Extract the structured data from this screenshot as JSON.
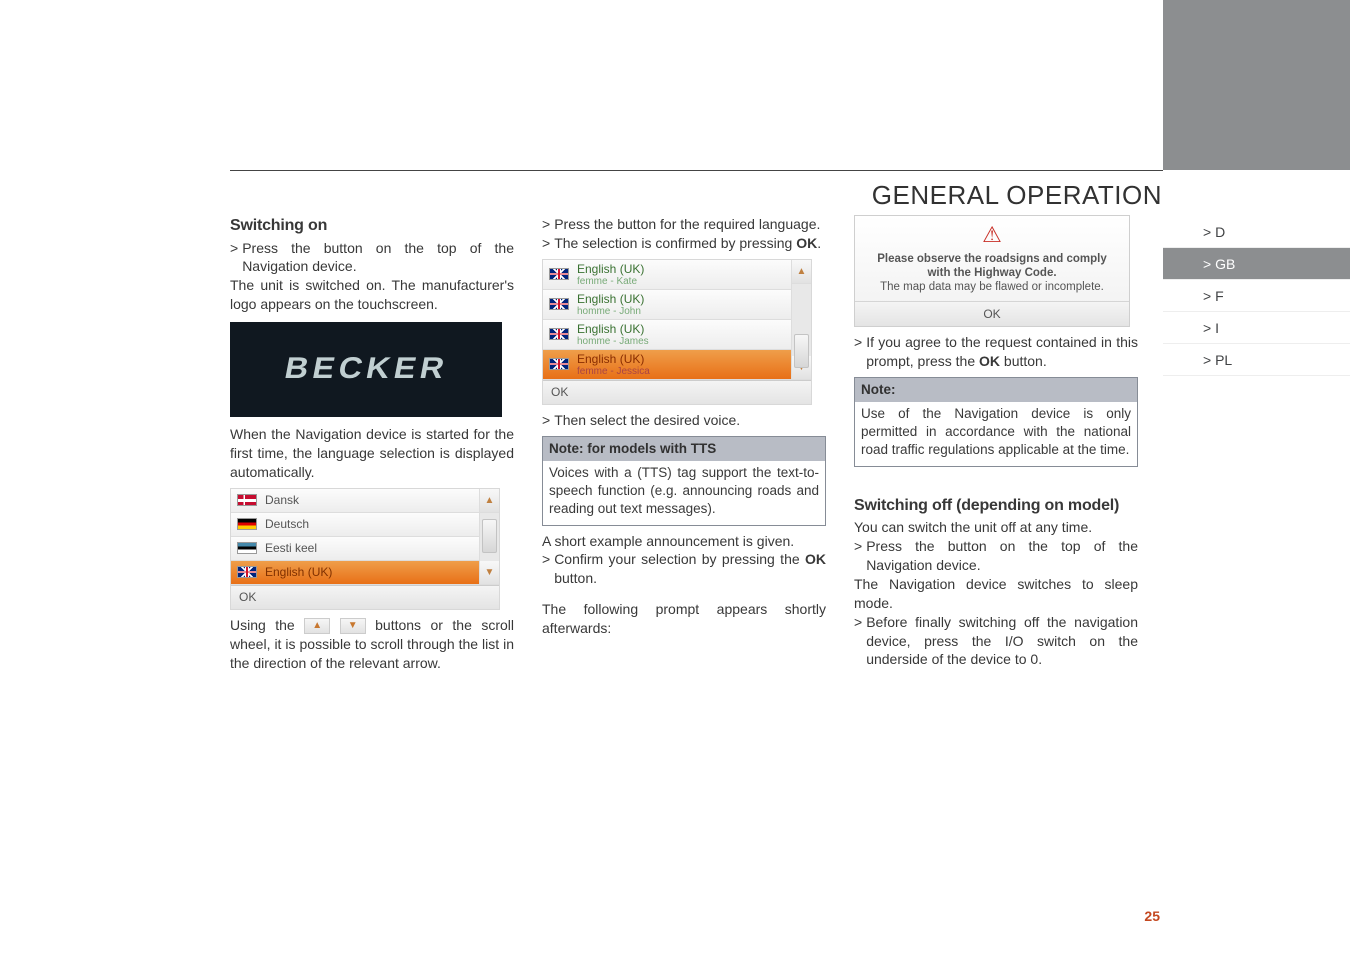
{
  "header": {
    "section": "GENERAL OPERATION",
    "chevrons": ">>>"
  },
  "sideNav": {
    "items": [
      "> D",
      "> GB",
      "> F",
      "> I",
      "> PL"
    ],
    "activeIndex": 1
  },
  "col1": {
    "h2": "Switching on",
    "p1_gt": ">",
    "p1": "Press the button on the top of the Navigation device.",
    "p2": "The unit is switched on. The manufacturer's logo appears on the touchscreen.",
    "becker": "BECKER",
    "p3": "When the Navigation device is started for the first time, the language selection is displayed automatically.",
    "langList": {
      "items": [
        {
          "flag": "flag-dk",
          "label": "Dansk"
        },
        {
          "flag": "flag-de",
          "label": "Deutsch"
        },
        {
          "flag": "flag-ee",
          "label": "Eesti keel"
        },
        {
          "flag": "flag-uk",
          "label": "English (UK)",
          "selected": true
        }
      ],
      "ok": "OK",
      "arrowUp": "▲",
      "arrowDown": "▼"
    },
    "p4a": "Using the ",
    "btnUp": "▲",
    "btnDown": "▼",
    "p4b": " buttons or the scroll wheel, it is possible to scroll through the list in the direction of the relevant arrow."
  },
  "col2": {
    "p1_gt": ">",
    "p1": "Press the button for the required language.",
    "p2_gt": ">",
    "p2a": "The selection is confirmed by pressing ",
    "p2b": "OK",
    "p2c": ".",
    "voiceList": {
      "items": [
        {
          "flag": "flag-uk",
          "main": "English (UK)",
          "sub": "femme - Kate"
        },
        {
          "flag": "flag-uk",
          "main": "English (UK)",
          "sub": "homme - John"
        },
        {
          "flag": "flag-uk",
          "main": "English (UK)",
          "sub": "homme - James"
        },
        {
          "flag": "flag-uk",
          "main": "English (UK)",
          "sub": "femme - Jessica",
          "selected": true
        }
      ],
      "ok": "OK",
      "arrowUp": "▲",
      "arrowDown": "▼"
    },
    "p3_gt": ">",
    "p3": "Then select the desired voice.",
    "note1Head": "Note: for models with TTS",
    "note1Body": "Voices with a (TTS) tag support the text-to-speech function (e.g. announcing roads and reading out text messages).",
    "p4": "A short example announcement is given.",
    "p5_gt": ">",
    "p5a": "Confirm your selection by pressing the ",
    "p5b": "OK",
    "p5c": " button.",
    "p6": "The following prompt appears shortly afterwards:"
  },
  "col3": {
    "prompt": {
      "warn": "⚠",
      "line1": "Please observe the roadsigns and comply with the Highway Code.",
      "line2": "The map data may be flawed or incomplete.",
      "ok": "OK"
    },
    "p1_gt": ">",
    "p1a": "If you agree to the request contained in this prompt, press the ",
    "p1b": "OK",
    "p1c": " button.",
    "note2Head": "Note:",
    "note2Body": "Use of the Navigation device is only permitted in accordance with the national road traffic regulations applicable at the time.",
    "h2": "Switching off (depending on model)",
    "p2": "You can switch the unit off at any time.",
    "p3_gt": ">",
    "p3": "Press the button on the top of the Navigation device.",
    "p4": "The Navigation device switches to sleep mode.",
    "p5_gt": ">",
    "p5": "Before finally switching off the navigation device, press the I/O switch on the underside of the device to 0."
  },
  "pageNum": "25"
}
